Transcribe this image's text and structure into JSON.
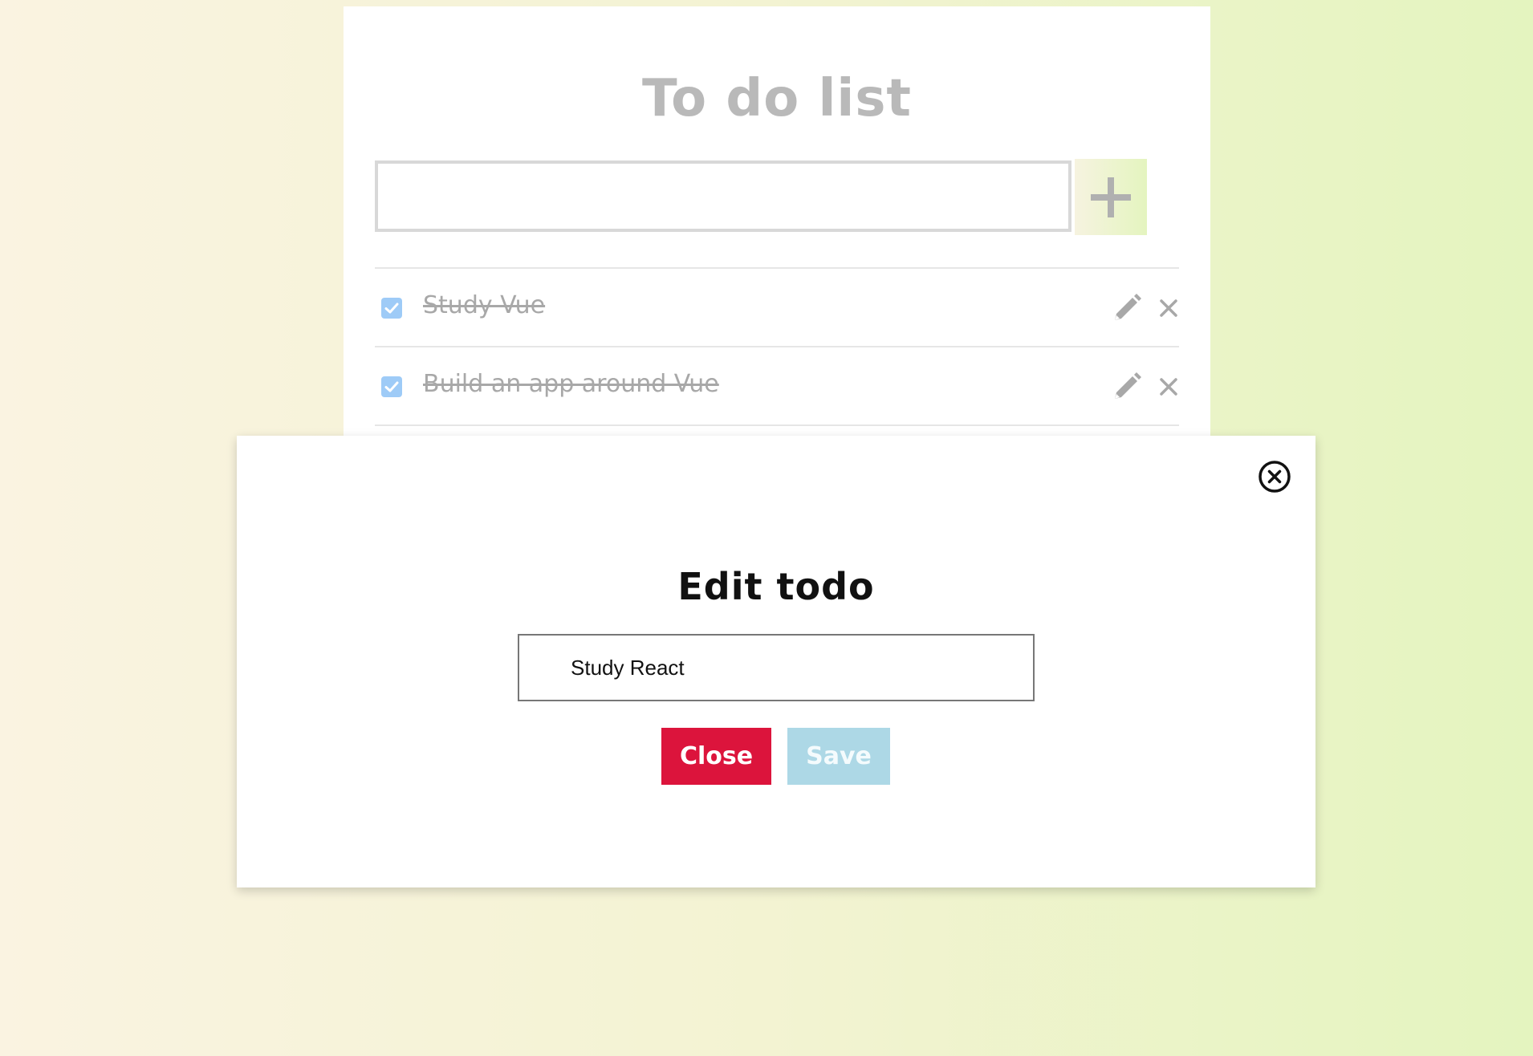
{
  "app": {
    "title": "To do list",
    "new_todo": {
      "value": "",
      "placeholder": ""
    },
    "add_button_icon": "plus-icon",
    "todos": [
      {
        "text": "Study Vue",
        "completed": true
      },
      {
        "text": "Build an app around Vue",
        "completed": true
      }
    ]
  },
  "modal": {
    "title": "Edit todo",
    "input_value": "Study React",
    "close_label": "Close",
    "save_label": "Save",
    "close_icon": "close-circle-icon"
  },
  "colors": {
    "close_button": "#dc143c",
    "save_button": "#add8e6",
    "checkbox": "#9ecbf7",
    "muted_text": "#a8a8a8"
  }
}
